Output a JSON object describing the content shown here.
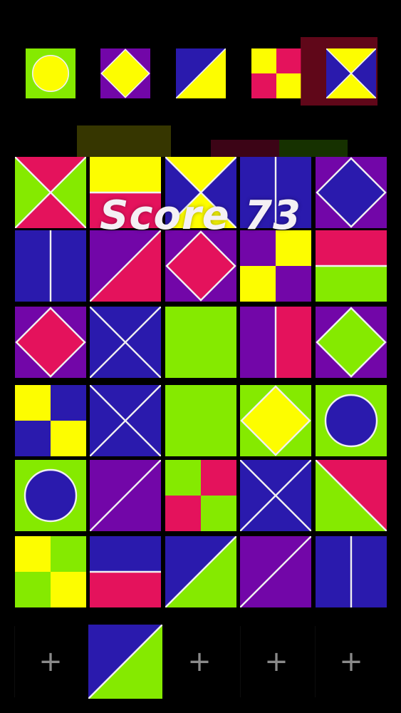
{
  "score": {
    "label": "Score 73"
  },
  "colors": {
    "red": "#e4125c",
    "green": "#85ea00",
    "blue": "#2a1aad",
    "yellow": "#fdfd00",
    "purple": "#7206a8",
    "line": "#f0f0f0",
    "background": "#000000"
  },
  "preview": [
    {
      "pattern": "circle",
      "colors": [
        "green",
        "yellow"
      ]
    },
    {
      "pattern": "diamond",
      "colors": [
        "purple",
        "yellow"
      ]
    },
    {
      "pattern": "diag-up",
      "colors": [
        "blue",
        "yellow"
      ]
    },
    {
      "pattern": "quad",
      "colors": [
        "yellow",
        "red",
        "red",
        "yellow"
      ]
    },
    {
      "pattern": "hourglass",
      "colors": [
        "blue",
        "yellow"
      ],
      "selected": true
    }
  ],
  "board": [
    [
      {
        "pattern": "x-tri",
        "colors": [
          "red",
          "green"
        ]
      },
      {
        "pattern": "half-h",
        "colors": [
          "yellow",
          "red"
        ]
      },
      {
        "pattern": "x-tri",
        "colors": [
          "yellow",
          "blue"
        ]
      },
      {
        "pattern": "vline",
        "colors": [
          "blue"
        ]
      },
      {
        "pattern": "diamond",
        "colors": [
          "purple",
          "blue"
        ]
      }
    ],
    [
      {
        "pattern": "vline",
        "colors": [
          "blue"
        ]
      },
      {
        "pattern": "diag-up",
        "colors": [
          "purple",
          "red"
        ]
      },
      {
        "pattern": "diamond",
        "colors": [
          "purple",
          "red"
        ]
      },
      {
        "pattern": "quad",
        "colors": [
          "purple",
          "yellow",
          "yellow",
          "purple"
        ]
      },
      {
        "pattern": "half-h",
        "colors": [
          "red",
          "green"
        ]
      }
    ],
    [
      {
        "pattern": "diamond",
        "colors": [
          "purple",
          "red"
        ]
      },
      {
        "pattern": "x-lines",
        "colors": [
          "blue"
        ]
      },
      {
        "pattern": "solid",
        "colors": [
          "green"
        ]
      },
      {
        "pattern": "half-v",
        "colors": [
          "purple",
          "red"
        ]
      },
      {
        "pattern": "diamond",
        "colors": [
          "purple",
          "green"
        ]
      }
    ],
    [
      {
        "pattern": "quad",
        "colors": [
          "yellow",
          "blue",
          "blue",
          "yellow"
        ]
      },
      {
        "pattern": "x-lines",
        "colors": [
          "blue"
        ]
      },
      {
        "pattern": "solid",
        "colors": [
          "green"
        ]
      },
      {
        "pattern": "diamond",
        "colors": [
          "green",
          "yellow"
        ]
      },
      {
        "pattern": "circle",
        "colors": [
          "green",
          "blue"
        ]
      }
    ],
    [
      {
        "pattern": "circle",
        "colors": [
          "green",
          "blue"
        ]
      },
      {
        "pattern": "diag-up",
        "colors": [
          "purple",
          "purple"
        ]
      },
      {
        "pattern": "quad",
        "colors": [
          "green",
          "red",
          "red",
          "green"
        ]
      },
      {
        "pattern": "x-lines",
        "colors": [
          "blue"
        ]
      },
      {
        "pattern": "diag-down",
        "colors": [
          "red",
          "green"
        ]
      }
    ],
    [
      {
        "pattern": "quad",
        "colors": [
          "yellow",
          "green",
          "green",
          "yellow"
        ]
      },
      {
        "pattern": "half-h",
        "colors": [
          "blue",
          "red"
        ]
      },
      {
        "pattern": "diag-up",
        "colors": [
          "blue",
          "green"
        ]
      },
      {
        "pattern": "diag-up",
        "colors": [
          "purple",
          "purple"
        ]
      },
      {
        "pattern": "vline",
        "colors": [
          "blue"
        ]
      }
    ]
  ],
  "tray": [
    {
      "empty": true,
      "symbol": "+"
    },
    {
      "empty": false,
      "pattern": "diag-up",
      "colors": [
        "blue",
        "green"
      ]
    },
    {
      "empty": true,
      "symbol": "+"
    },
    {
      "empty": true,
      "symbol": "+"
    },
    {
      "empty": true,
      "symbol": "+"
    }
  ]
}
